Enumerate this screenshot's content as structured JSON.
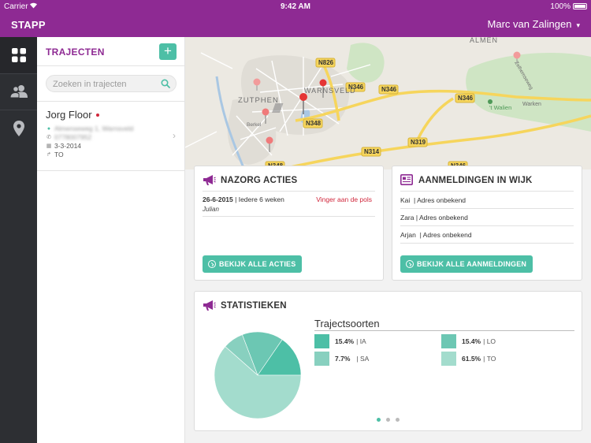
{
  "status_bar": {
    "carrier": "Carrier",
    "time": "9:42 AM",
    "battery": "100%"
  },
  "nav": {
    "app_title": "STAPP",
    "user_name": "Marc van Zalingen",
    "user_chevron": "⌄"
  },
  "rail": {
    "items": [
      "dashboard-icon",
      "clients-icon",
      "location-icon"
    ]
  },
  "list_panel": {
    "title": "TRAJECTEN",
    "add_label": "+",
    "search_placeholder": "Zoeken in trajecten",
    "items": [
      {
        "name": "Jorg Floor",
        "address": "Almenseweg 1, Warnsveld",
        "phone": "0778007952",
        "date": "3-3-2014",
        "type": "TO"
      }
    ]
  },
  "map": {
    "labels": {
      "almen": "ALMEN",
      "warnsveld": "WARNSVELD",
      "zutphen": "ZUTPHEN",
      "walien": "'t Walien",
      "warken": "Warken",
      "zelhem": "Zelhemseweg",
      "berkel": "Berkel"
    },
    "roads": [
      "N826",
      "N346",
      "N346",
      "N346",
      "N348",
      "N314",
      "N319",
      "N348",
      "N346"
    ]
  },
  "nazorg": {
    "title": "NAZORG ACTIES",
    "date": "26-6-2015",
    "frequency": "Iedere 6 weken",
    "tag": "Vinger aan de pols",
    "person": "Julian",
    "button": "BEKIJK ALLE ACTIES"
  },
  "aanmeldingen": {
    "title": "AANMELDINGEN IN WIJK",
    "rows": [
      {
        "name": "Kai",
        "detail": "Adres onbekend"
      },
      {
        "name": "Zara",
        "detail": "Adres onbekend"
      },
      {
        "name": "Arjan",
        "detail": "Adres onbekend"
      }
    ],
    "button": "BEKIJK ALLE AANMELDINGEN"
  },
  "statistieken": {
    "title": "STATISTIEKEN",
    "legend_title": "Trajectsoorten",
    "legend": [
      {
        "pct": "15.4%",
        "label": "IA",
        "color": "#4dbfa6"
      },
      {
        "pct": "15.4%",
        "label": "LO",
        "color": "#6cc7b3"
      },
      {
        "pct": "7.7%",
        "label": "SA",
        "color": "#88d0bf"
      },
      {
        "pct": "61.5%",
        "label": "TO",
        "color": "#a3dccd"
      }
    ],
    "pages": 3,
    "active_page": 1
  },
  "chart_data": {
    "type": "pie",
    "title": "Trajectsoorten",
    "categories": [
      "IA",
      "LO",
      "SA",
      "TO"
    ],
    "values": [
      15.4,
      15.4,
      7.7,
      61.5
    ],
    "colors": [
      "#4dbfa6",
      "#6cc7b3",
      "#88d0bf",
      "#a3dccd"
    ]
  },
  "colors": {
    "brand": "#8e2a93",
    "accent": "#4dbfa6",
    "rail": "#2d2f33",
    "alert": "#d0263b"
  }
}
